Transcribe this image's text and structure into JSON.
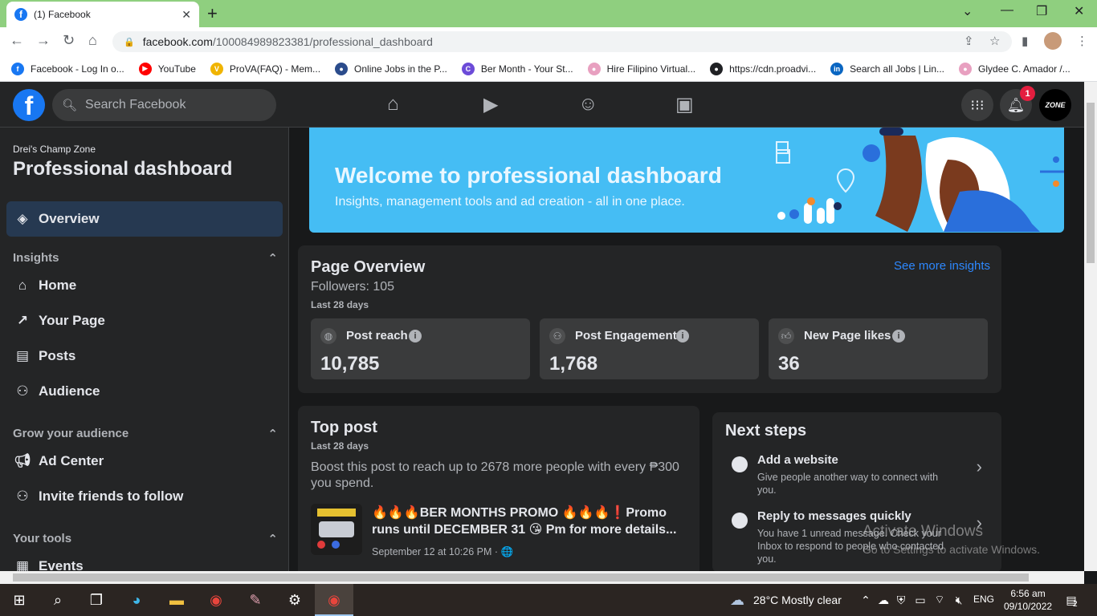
{
  "browser": {
    "tab_title": "(1) Facebook",
    "url_domain": "facebook.com",
    "url_path": "/100084989823381/professional_dashboard",
    "bookmarks": [
      {
        "label": "Facebook - Log In o...",
        "color": "#1877f2",
        "glyph": "f"
      },
      {
        "label": "YouTube",
        "color": "#ff0000",
        "glyph": "▶"
      },
      {
        "label": "ProVA(FAQ) - Mem...",
        "color": "#f0b400",
        "glyph": "V"
      },
      {
        "label": "Online Jobs in the P...",
        "color": "#2b4c8c",
        "glyph": "●"
      },
      {
        "label": "Ber Month - Your St...",
        "color": "#6c4bd8",
        "glyph": "C"
      },
      {
        "label": "Hire Filipino Virtual...",
        "color": "#e8a0c0",
        "glyph": "●"
      },
      {
        "label": "https://cdn.proadvi...",
        "color": "#202124",
        "glyph": "●"
      },
      {
        "label": "Search all Jobs | Lin...",
        "color": "#0a66c2",
        "glyph": "in"
      },
      {
        "label": "Glydee C. Amador /...",
        "color": "#e8a0c0",
        "glyph": "●"
      }
    ]
  },
  "header": {
    "search_placeholder": "Search Facebook",
    "notification_count": "1",
    "avatar_text": "ZONE"
  },
  "sidebar": {
    "owner": "Drei's Champ Zone",
    "title": "Professional dashboard",
    "overview": "Overview",
    "sections": {
      "insights": "Insights",
      "grow": "Grow your audience",
      "tools": "Your tools"
    },
    "items": {
      "home": "Home",
      "your_page": "Your Page",
      "posts": "Posts",
      "audience": "Audience",
      "ad_center": "Ad Center",
      "invite": "Invite friends to follow",
      "events": "Events"
    }
  },
  "banner": {
    "title": "Welcome to professional dashboard",
    "subtitle": "Insights, management tools and ad creation - all in one place."
  },
  "page_overview": {
    "title": "Page Overview",
    "followers": "Followers: 105",
    "period": "Last 28 days",
    "see_more": "See more insights",
    "metrics": [
      {
        "label": "Post reach",
        "value": "10,785"
      },
      {
        "label": "Post Engagement",
        "value": "1,768"
      },
      {
        "label": "New Page likes",
        "value": "36"
      }
    ]
  },
  "top_post": {
    "title": "Top post",
    "period": "Last 28 days",
    "boost_text": "Boost this post to reach up to 2678 more people with every ₱300 you spend.",
    "post_text": "🔥🔥🔥BER MONTHS PROMO 🔥🔥🔥❗Promo runs until DECEMBER 31 😘 Pm for more details...",
    "post_date": "September 12 at 10:26 PM · 🌐"
  },
  "next_steps": {
    "title": "Next steps",
    "steps": [
      {
        "title": "Add a website",
        "desc": "Give people another way to connect with you."
      },
      {
        "title": "Reply to messages quickly",
        "desc": "You have 1 unread message. Check your Inbox to respond to people who contacted you."
      }
    ]
  },
  "watermark": {
    "line1": "Activate Windows",
    "line2": "Go to Settings to activate Windows."
  },
  "taskbar": {
    "weather": "28°C  Mostly clear",
    "lang": "ENG",
    "time": "6:56 am",
    "date": "09/10/2022",
    "notif_count": "2"
  }
}
